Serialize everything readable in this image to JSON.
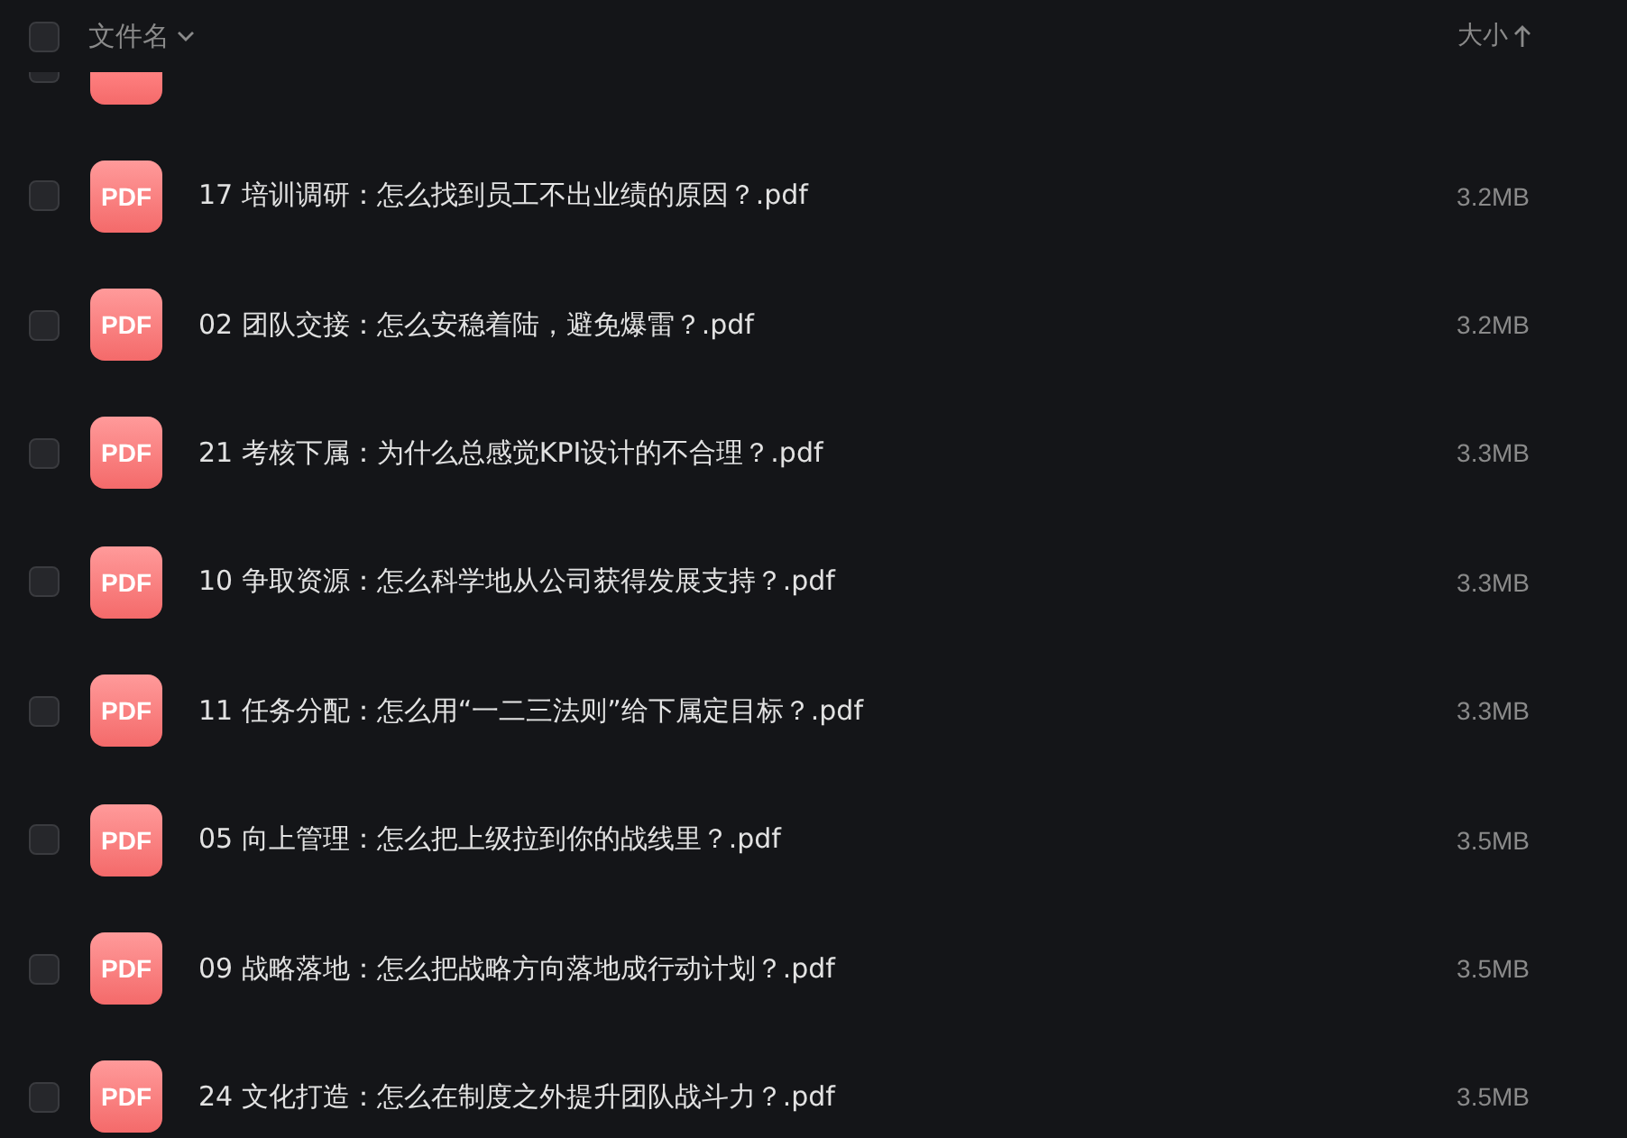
{
  "header": {
    "select_all": {
      "checked": false
    },
    "name_column": "文件名",
    "size_column": "大小"
  },
  "partial_row": {
    "checked": false
  },
  "files": [
    {
      "icon_label": "PDF",
      "name": "17 培训调研：怎么找到员工不出业绩的原因？.pdf",
      "size": "3.2MB",
      "checked": false
    },
    {
      "icon_label": "PDF",
      "name": "02 团队交接：怎么安稳着陆，避免爆雷？.pdf",
      "size": "3.2MB",
      "checked": false
    },
    {
      "icon_label": "PDF",
      "name": "21 考核下属：为什么总感觉KPI设计的不合理？.pdf",
      "size": "3.3MB",
      "checked": false
    },
    {
      "icon_label": "PDF",
      "name": "10 争取资源：怎么科学地从公司获得发展支持？.pdf",
      "size": "3.3MB",
      "checked": false
    },
    {
      "icon_label": "PDF",
      "name": "11 任务分配：怎么用“一二三法则”给下属定目标？.pdf",
      "size": "3.3MB",
      "checked": false
    },
    {
      "icon_label": "PDF",
      "name": "05 向上管理：怎么把上级拉到你的战线里？.pdf",
      "size": "3.5MB",
      "checked": false
    },
    {
      "icon_label": "PDF",
      "name": "09 战略落地：怎么把战略方向落地成行动计划？.pdf",
      "size": "3.5MB",
      "checked": false
    },
    {
      "icon_label": "PDF",
      "name": "24 文化打造：怎么在制度之外提升团队战斗力？.pdf",
      "size": "3.5MB",
      "checked": false
    }
  ]
}
